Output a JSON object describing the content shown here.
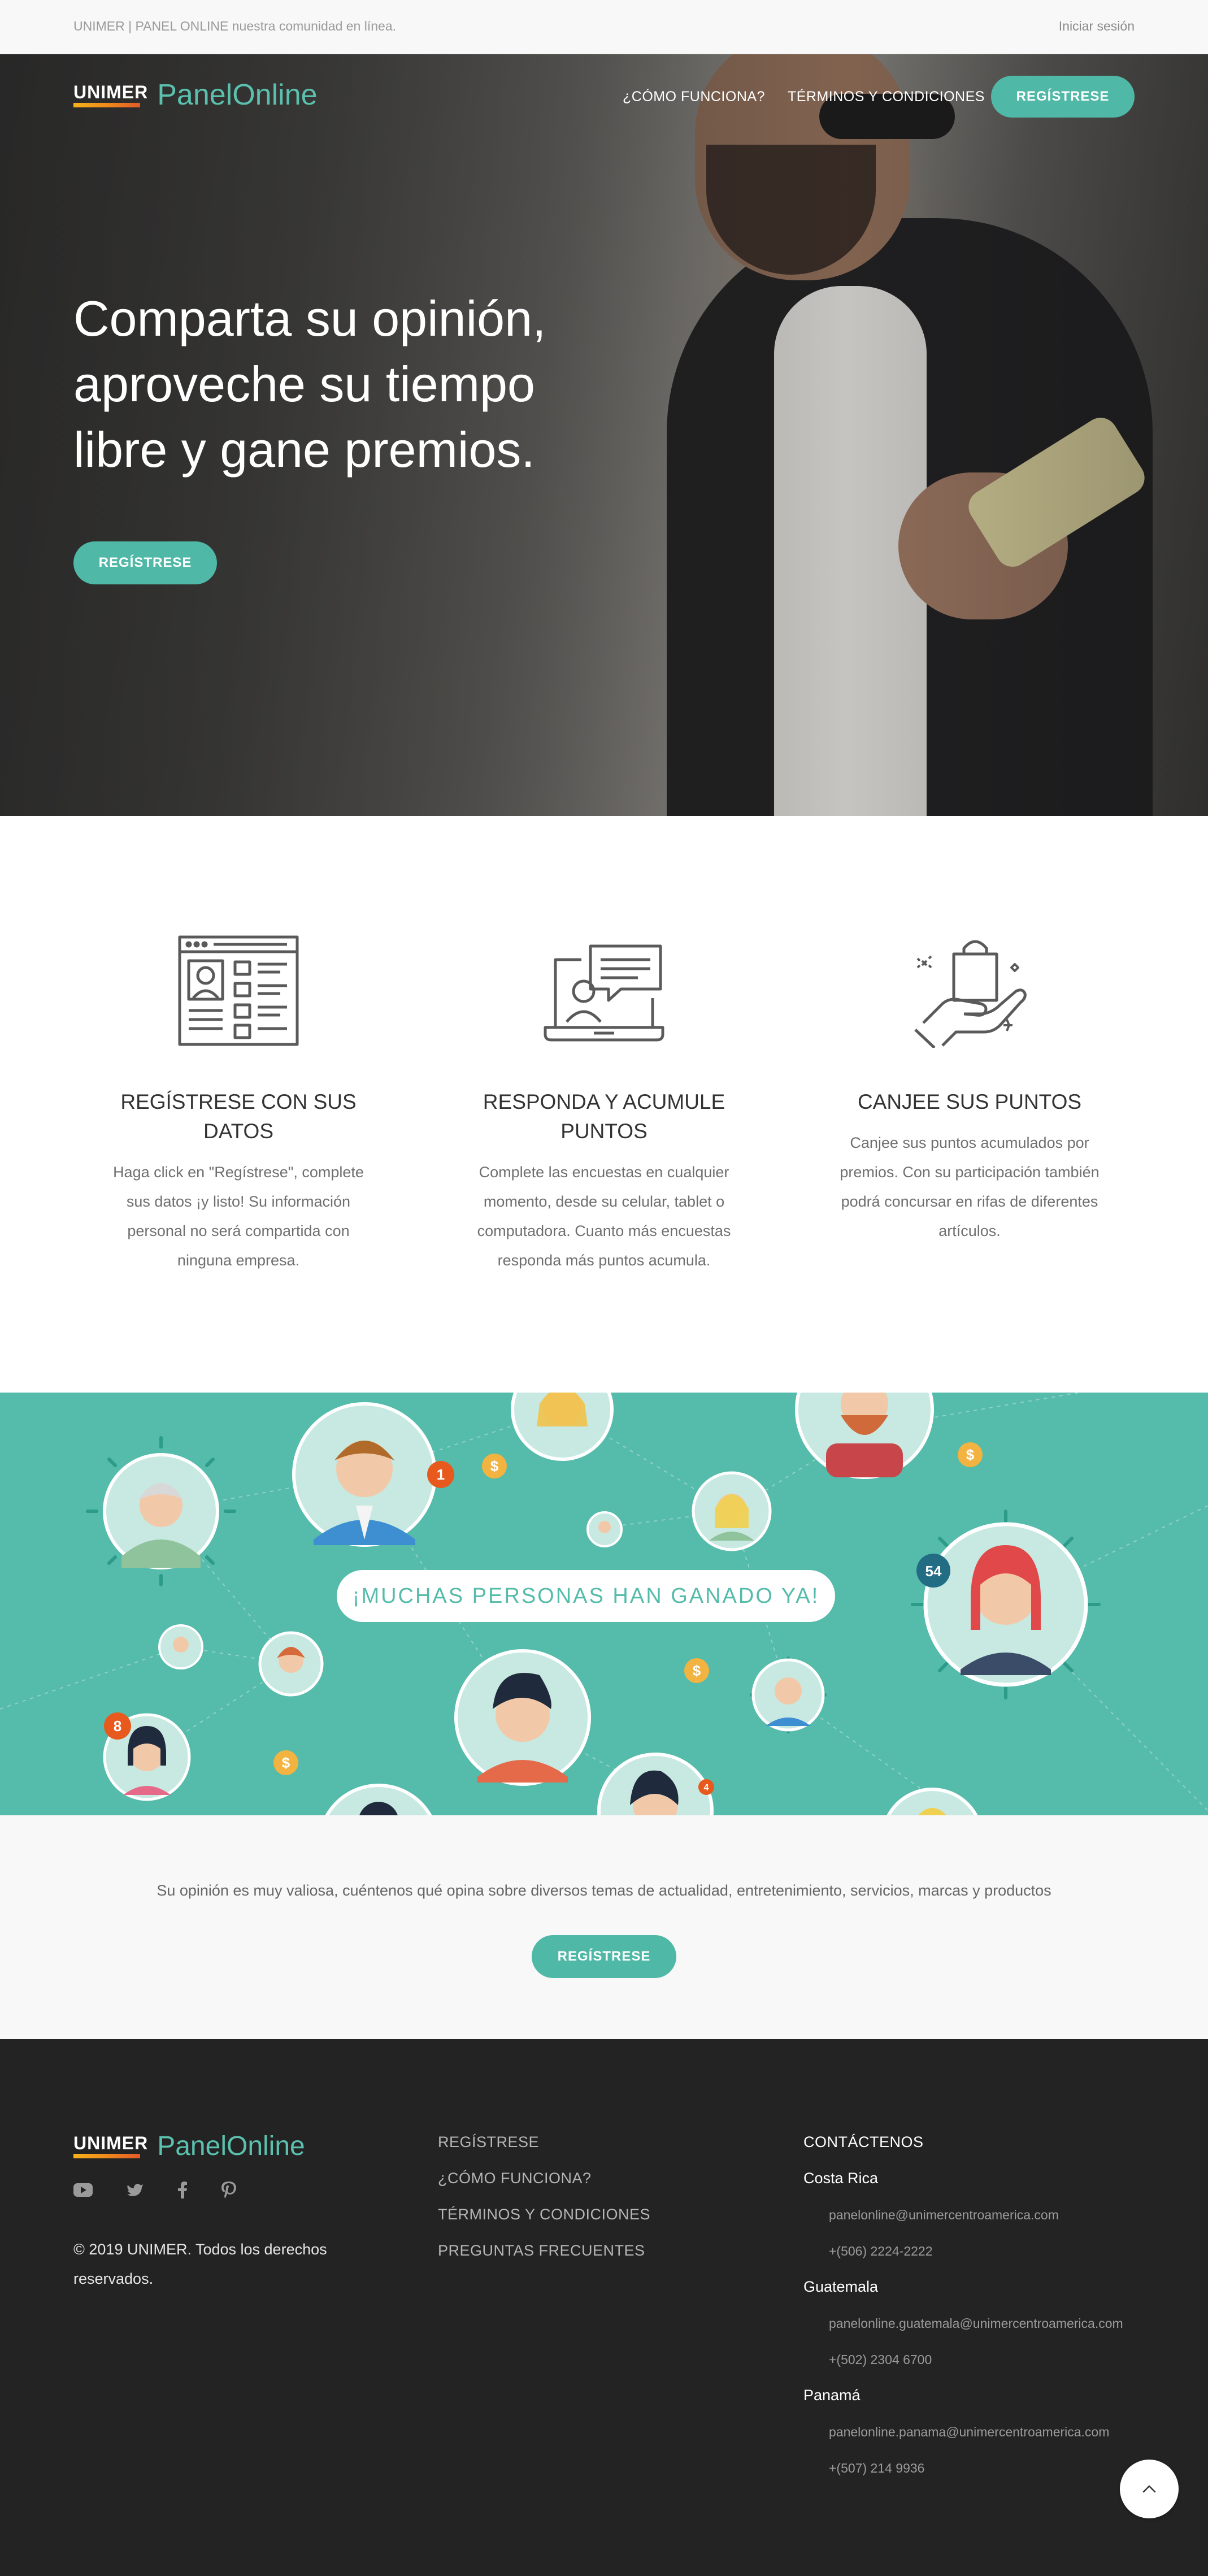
{
  "topbar": {
    "tagline": "UNIMER | PANEL ONLINE nuestra comunidad en línea.",
    "login": "Iniciar sesión"
  },
  "brand": {
    "unimer": "UNIMER",
    "panel": "PanelOnline",
    "accent_color": "#4fb8a6",
    "logo_stripe_colors": [
      "#f6b21b",
      "#f08a1c",
      "#e25a2a"
    ]
  },
  "nav": {
    "links": [
      "¿CÓMO FUNCIONA?",
      "TÉRMINOS Y CONDICIONES"
    ],
    "register": "REGÍSTRESE"
  },
  "hero": {
    "title": "Comparta su opinión, aproveche su tiempo libre y gane premios.",
    "button": "REGÍSTRESE"
  },
  "steps": [
    {
      "icon": "web-form-icon",
      "title": "REGÍSTRESE CON SUS DATOS",
      "text": "Haga click en \"Regístrese\", complete sus datos ¡y listo! Su información personal no será compartida con ninguna empresa."
    },
    {
      "icon": "laptop-chat-icon",
      "title": "RESPONDA Y ACUMULE PUNTOS",
      "text": "Complete las encuestas en cualquier momento, desde su celular, tablet o computadora. Cuanto más encuestas responda más puntos acumula."
    },
    {
      "icon": "gift-bag-hand-icon",
      "title": "CANJEE SUS PUNTOS",
      "text": "Canjee sus puntos acumulados por premios. Con su participación también podrá concursar en rifas de diferentes artículos."
    }
  ],
  "banner": {
    "headline": "¡MUCHAS PERSONAS HAN GANADO YA!",
    "badges": [
      "1",
      "54",
      "8",
      "4"
    ],
    "coin_symbol": "$"
  },
  "cta": {
    "text": "Su opinión es muy valiosa, cuéntenos qué opina sobre diversos temas de actualidad, entretenimiento, servicios, marcas y productos",
    "button": "REGÍSTRESE"
  },
  "footer": {
    "social_icons": [
      "youtube-icon",
      "twitter-icon",
      "facebook-icon",
      "pinterest-icon"
    ],
    "copyright": "© 2019 UNIMER. Todos los derechos reservados.",
    "links": [
      "REGÍSTRESE",
      "¿CÓMO FUNCIONA?",
      "TÉRMINOS Y CONDICIONES",
      "PREGUNTAS FRECUENTES"
    ],
    "contact_title": "CONTÁCTENOS",
    "contacts": [
      {
        "country": "Costa Rica",
        "email": "panelonline@unimercentroamerica.com",
        "phone": "+(506) 2224-2222"
      },
      {
        "country": "Guatemala",
        "email": "panelonline.guatemala@unimercentroamerica.com",
        "phone": "+(502) 2304 6700"
      },
      {
        "country": "Panamá",
        "email": "panelonline.panama@unimercentroamerica.com",
        "phone": "+(507) 214 9936"
      }
    ]
  }
}
